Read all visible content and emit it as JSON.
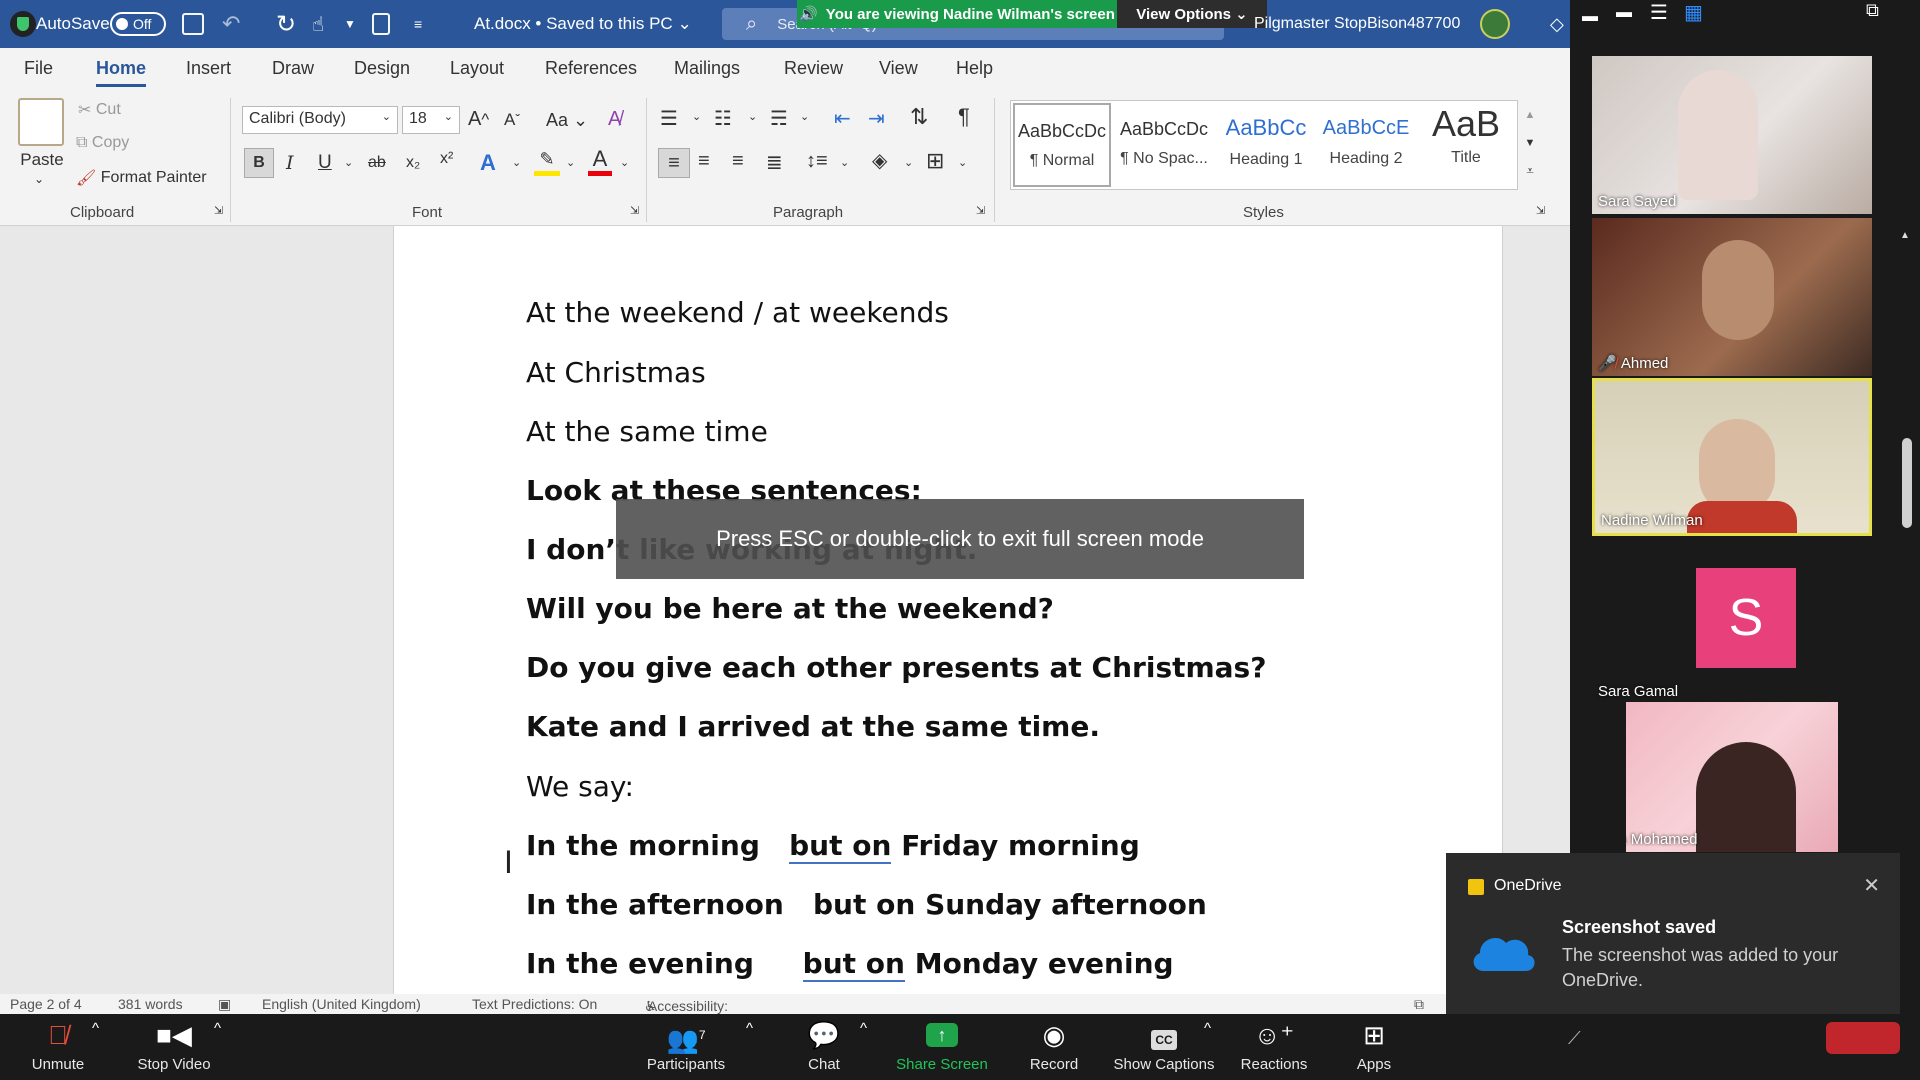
{
  "window": {
    "autosave_label": "AutoSave",
    "autosave_state": "Off",
    "doc_title": "At.docx • Saved to this PC",
    "search_placeholder": "Search (Alt+Q)",
    "user_name": "Pilgmaster StopBison487700",
    "screen_banner": "You are viewing Nadine Wilman's screen",
    "view_options": "View Options"
  },
  "menu": [
    "File",
    "Home",
    "Insert",
    "Draw",
    "Design",
    "Layout",
    "References",
    "Mailings",
    "Review",
    "View",
    "Help"
  ],
  "ribbon": {
    "clipboard": {
      "paste": "Paste",
      "cut": "Cut",
      "copy": "Copy",
      "format_painter": "Format Painter",
      "label": "Clipboard"
    },
    "font": {
      "family": "Calibri (Body)",
      "size": "18",
      "label": "Font",
      "bold": "B",
      "italic": "I",
      "underline": "U",
      "strike": "ab",
      "case": "Aa",
      "grow": "A",
      "shrink": "A"
    },
    "paragraph": {
      "label": "Paragraph"
    },
    "styles": {
      "label": "Styles",
      "items": [
        {
          "sample": "AaBbCcDc",
          "name": "¶ Normal"
        },
        {
          "sample": "AaBbCcDc",
          "name": "¶ No Spac..."
        },
        {
          "sample": "AaBbCc",
          "name": "Heading 1"
        },
        {
          "sample": "AaBbCcE",
          "name": "Heading 2"
        },
        {
          "sample": "AaB",
          "name": "Title"
        }
      ]
    }
  },
  "document": {
    "lines": [
      {
        "text": "At the weekend / at weekends",
        "bold": false
      },
      {
        "text": "At Christmas",
        "bold": false
      },
      {
        "text": "At the same time",
        "bold": false
      },
      {
        "text": "Look at these sentences:",
        "bold": true
      },
      {
        "text": "I don’t like working at night.",
        "bold": true
      },
      {
        "text": "Will you be here at the weekend?",
        "bold": true
      },
      {
        "text": "Do you give each other presents at Christmas?",
        "bold": true
      },
      {
        "text": "Kate and I arrived at the same time.",
        "bold": true
      },
      {
        "text": "We say:",
        "bold": false
      }
    ],
    "pairs": [
      {
        "a": "In the morning",
        "gap": "   ",
        "but": "but",
        "on": "on",
        "b": "Friday morning",
        "underline": true
      },
      {
        "a": "In the afternoon",
        "gap": "   ",
        "but": "but",
        "on": "on",
        "b": "Sunday afternoon",
        "underline": false
      },
      {
        "a": "In the evening",
        "gap": "     ",
        "but": "but",
        "on": "on",
        "b": "Monday evening",
        "underline": true
      }
    ]
  },
  "fullscreen_hint": "Press ESC or double-click to exit full screen mode",
  "status": {
    "page": "Page 2 of 4",
    "words": "381 words",
    "language": "English (United Kingdom)",
    "predictions": "Text Predictions: On",
    "accessibility": "Accessibility: Good to go"
  },
  "participants": [
    {
      "name": "Sara Sayed",
      "speaking": false,
      "muted": false
    },
    {
      "name": "Ahmed",
      "speaking": false,
      "muted": true
    },
    {
      "name": "Nadine Wilman",
      "speaking": true,
      "muted": false
    },
    {
      "name": "Sara Gamal",
      "initial": "S",
      "speaking": false,
      "muted": false
    },
    {
      "name": "Yara Mohamed",
      "speaking": false,
      "muted": false
    }
  ],
  "onedrive": {
    "app": "OneDrive",
    "title": "Screenshot saved",
    "body": "The screenshot was added to your OneDrive."
  },
  "zoom_toolbar": {
    "unmute": "Unmute",
    "stop_video": "Stop Video",
    "participants": "Participants",
    "participant_count": "7",
    "chat": "Chat",
    "share": "Share Screen",
    "record": "Record",
    "captions": "Show Captions",
    "reactions": "Reactions",
    "apps": "Apps"
  },
  "colors": {
    "word_blue": "#2b579a",
    "zoom_green": "#1fa44b",
    "speaker_yellow": "#e6e04a",
    "avatar_pink": "#e8407a"
  }
}
